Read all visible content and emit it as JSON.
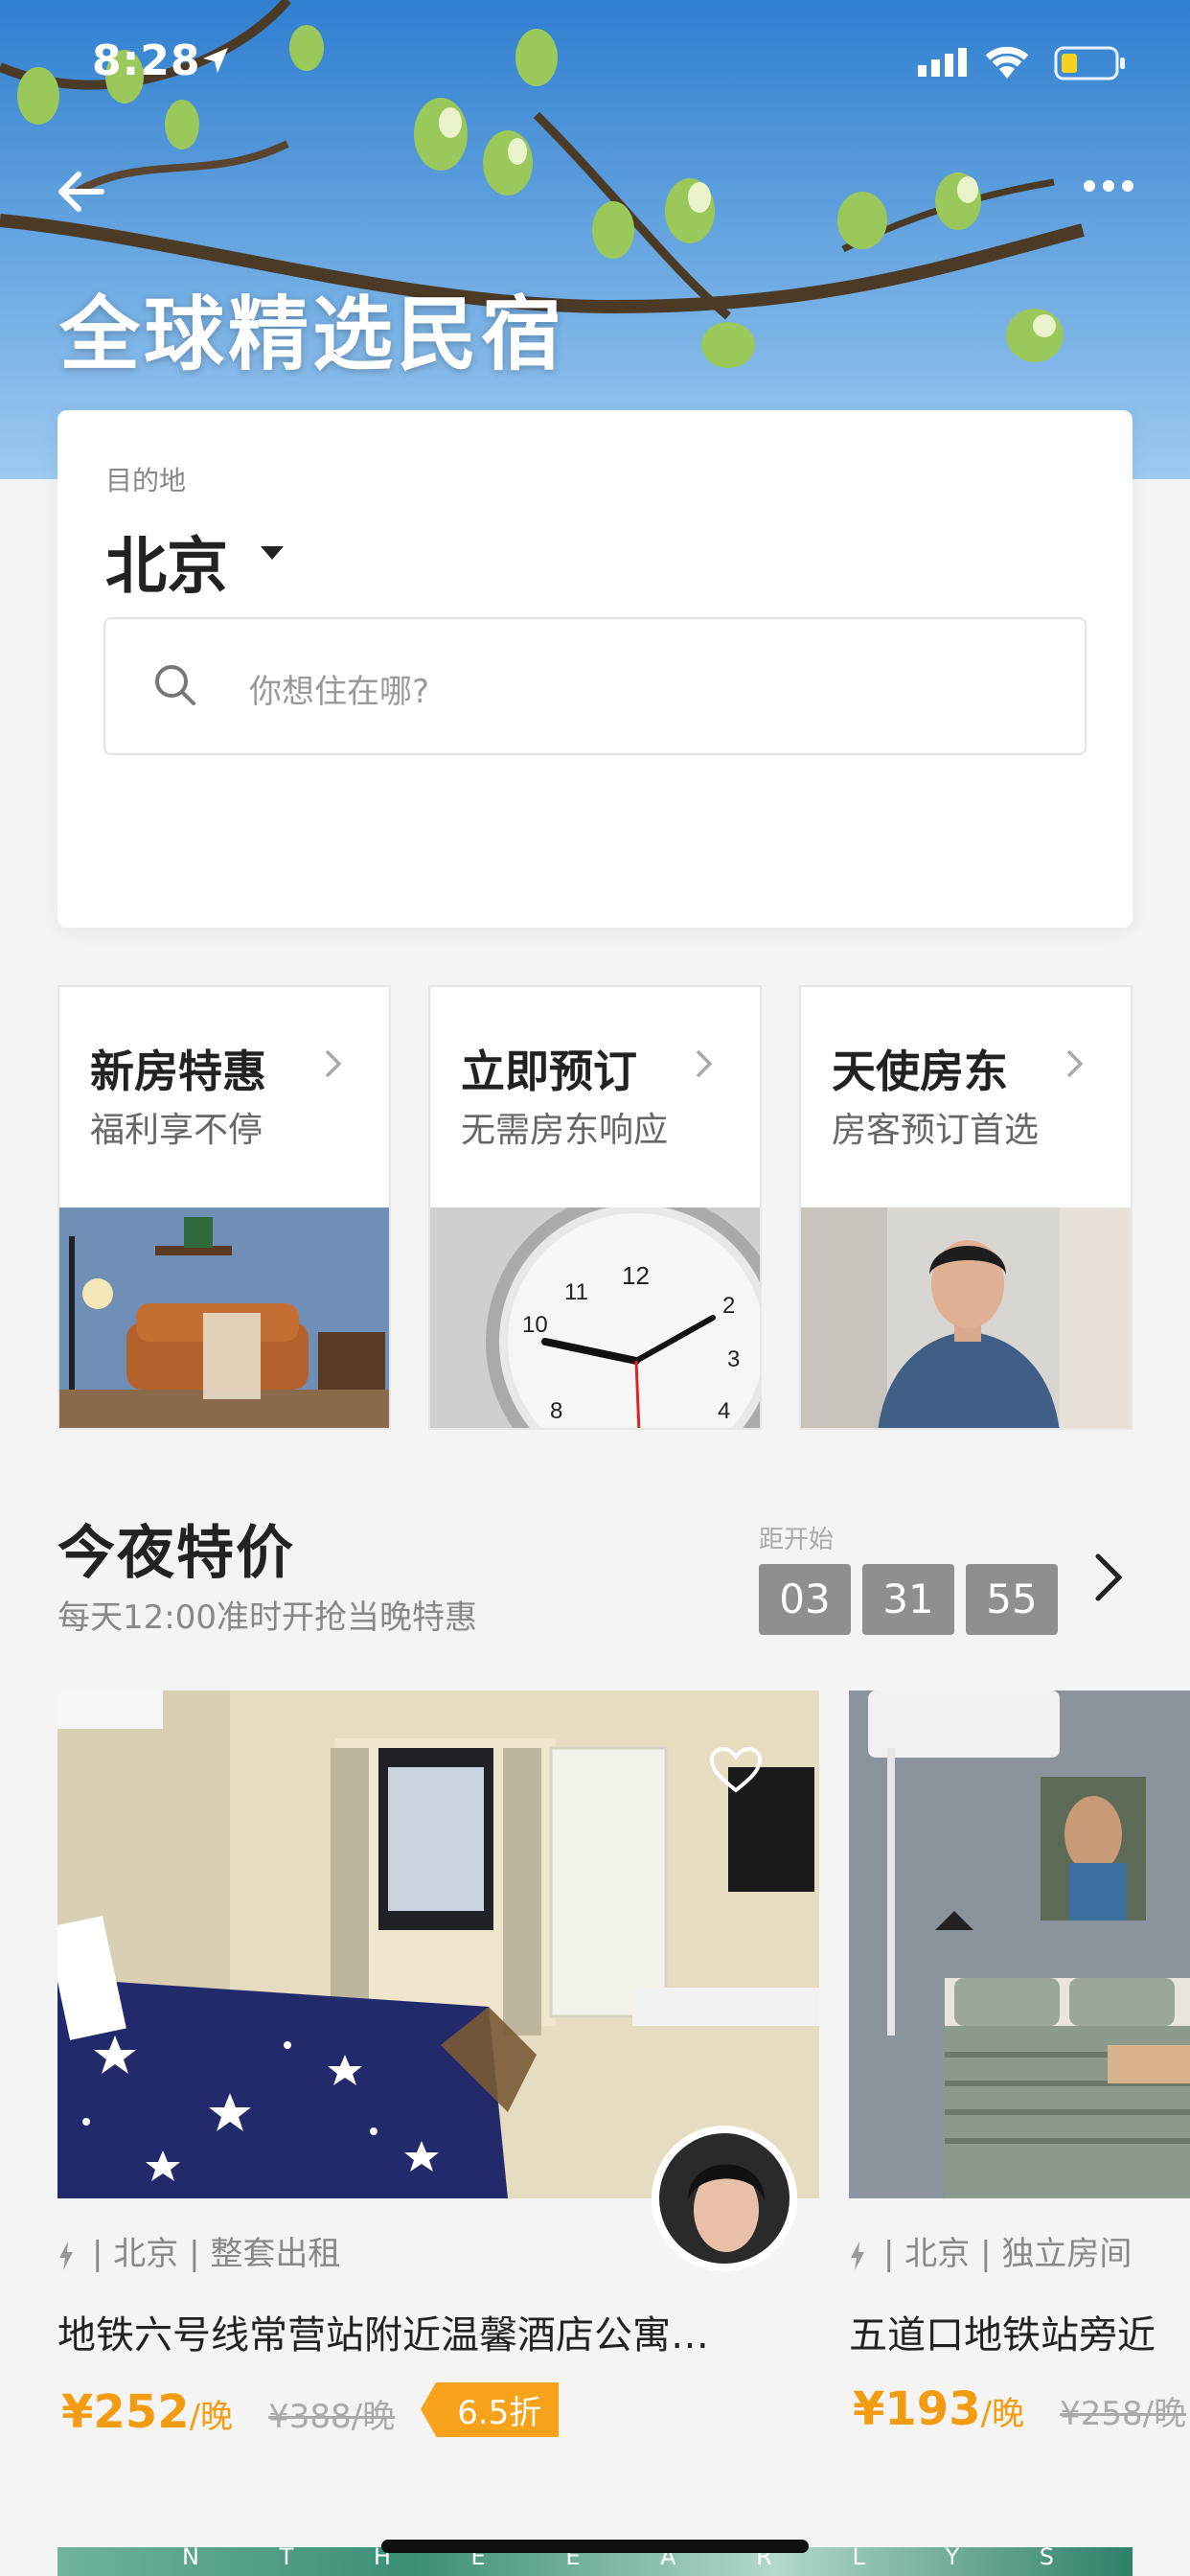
{
  "status_bar": {
    "time": "8:28"
  },
  "hero": {
    "title": "全球精选民宿"
  },
  "search_card": {
    "destination_label": "目的地",
    "destination_city": "北京",
    "search_placeholder": "你想住在哪?"
  },
  "feature_tiles": [
    {
      "title": "新房特惠",
      "subtitle": "福利享不停"
    },
    {
      "title": "立即预订",
      "subtitle": "无需房东响应"
    },
    {
      "title": "天使房东",
      "subtitle": "房客预订首选"
    }
  ],
  "tonight_deals": {
    "title": "今夜特价",
    "subtitle": "每天12:00准时开抢当晚特惠",
    "countdown_label": "距开始",
    "countdown": [
      "03",
      "31",
      "55"
    ]
  },
  "listings": [
    {
      "meta": "| 北京 | 整套出租",
      "name": "地铁六号线常营站附近温馨酒店公寓…",
      "price": "¥252",
      "per": "/晚",
      "original_price": "¥388/晚",
      "discount": "6.5折"
    },
    {
      "meta": "| 北京 | 独立房间",
      "name": "五道口地铁站旁近",
      "price": "¥193",
      "per": "/晚",
      "original_price": "¥258/晚"
    }
  ],
  "banner": {
    "text": "N T H E E A R L Y S U M M E R"
  },
  "colors": {
    "accent_orange": "#f39c12",
    "discount_bg": "#f7a21b",
    "countdown_bg": "#8f8f8f"
  }
}
